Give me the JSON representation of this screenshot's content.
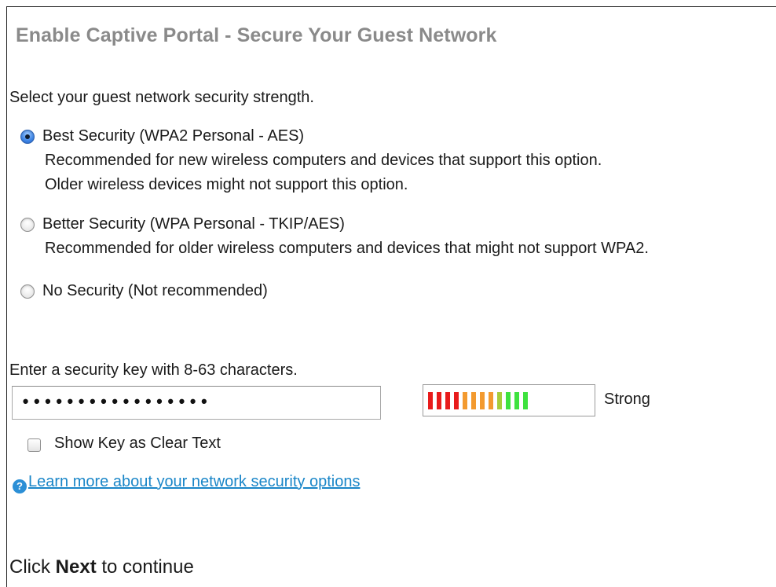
{
  "page": {
    "title": "Enable Captive Portal - Secure Your Guest Network",
    "intro": "Select your guest network security strength."
  },
  "security_options": [
    {
      "label": "Best Security (WPA2 Personal - AES)",
      "description": [
        "Recommended for new wireless computers and devices that support this option.",
        "Older wireless devices might not support this option."
      ],
      "selected": true
    },
    {
      "label": "Better Security (WPA Personal - TKIP/AES)",
      "description": [
        "Recommended for older wireless computers and devices that might not support WPA2."
      ],
      "selected": false
    },
    {
      "label": "No Security (Not recommended)",
      "description": [],
      "selected": false
    }
  ],
  "security_key": {
    "label": "Enter a security key with 8-63 characters.",
    "value": "•••••••••••••••••"
  },
  "strength_meter": {
    "label": "Strong",
    "bars": [
      {
        "color": "#e81b1b"
      },
      {
        "color": "#e81b1b"
      },
      {
        "color": "#e81b1b"
      },
      {
        "color": "#e81b1b"
      },
      {
        "color": "#f39a2f"
      },
      {
        "color": "#f39a2f"
      },
      {
        "color": "#f39a2f"
      },
      {
        "color": "#f39a2f"
      },
      {
        "color": "#a8cc3a"
      },
      {
        "color": "#3ee23e"
      },
      {
        "color": "#3ee23e"
      },
      {
        "color": "#3ee23e"
      }
    ]
  },
  "show_key": {
    "label": "Show Key as Clear Text",
    "checked": false
  },
  "help": {
    "icon": "help-circle-icon",
    "link_text": "Learn more about your network security options"
  },
  "footer": {
    "prefix": "Click ",
    "emphasis": "Next",
    "suffix": " to continue"
  },
  "colors": {
    "title": "#8a8a8a",
    "link": "#1a86c8",
    "radio_selected": "#3f86e6"
  }
}
